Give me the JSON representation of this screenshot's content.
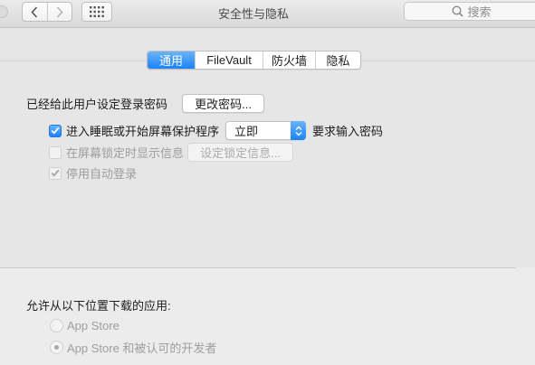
{
  "window": {
    "title": "安全性与隐私",
    "search_placeholder": "搜索"
  },
  "toolbar": {
    "icons": [
      "back-chevron-icon",
      "forward-chevron-icon",
      "grid-icon",
      "search-icon"
    ]
  },
  "tabs": [
    {
      "label": "通用",
      "active": true
    },
    {
      "label": "FileVault",
      "active": false
    },
    {
      "label": "防火墙",
      "active": false
    },
    {
      "label": "隐私",
      "active": false
    }
  ],
  "general": {
    "password_set_label": "已经给此用户设定登录密码",
    "change_password_button": "更改密码...",
    "require_password": {
      "checked": true,
      "prefix": "进入睡眠或开始屏幕保护程序",
      "select_value": "立即",
      "suffix": "要求输入密码"
    },
    "show_message": {
      "checked": false,
      "enabled": false,
      "label": "在屏幕锁定时显示信息",
      "button": "设定锁定信息..."
    },
    "disable_auto_login": {
      "checked": true,
      "enabled": false,
      "label": "停用自动登录"
    }
  },
  "downloads": {
    "heading": "允许从以下位置下载的应用:",
    "options": [
      {
        "label": "App Store",
        "selected": false
      },
      {
        "label": "App Store 和被认可的开发者",
        "selected": true
      }
    ]
  },
  "colors": {
    "accent": "#1a82fb",
    "disabled_text": "#9e9e9e"
  }
}
